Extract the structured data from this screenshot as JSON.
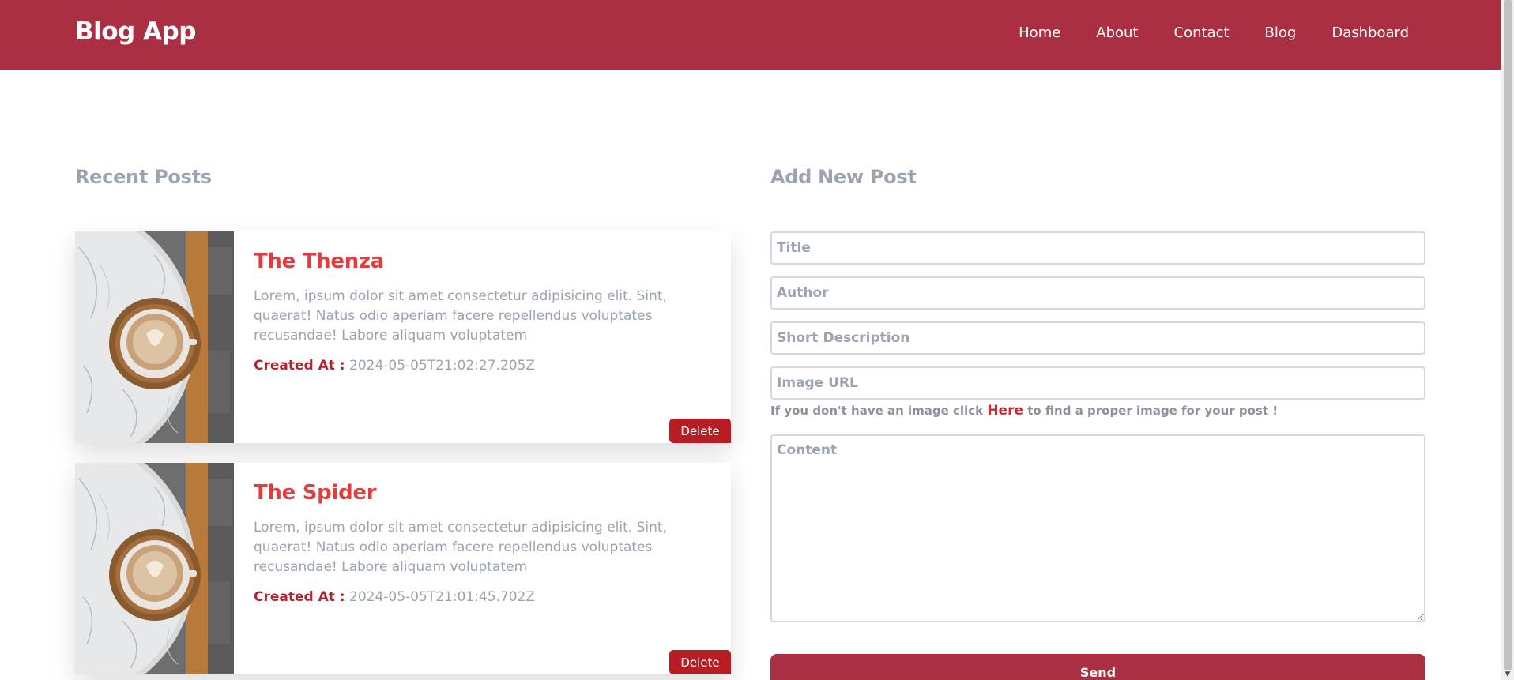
{
  "navbar": {
    "brand": "Blog App",
    "links": [
      "Home",
      "About",
      "Contact",
      "Blog",
      "Dashboard"
    ]
  },
  "recent_posts": {
    "heading": "Recent Posts",
    "created_label": "Created At :",
    "delete_label": "Delete",
    "posts": [
      {
        "title": "The Thenza",
        "description": "Lorem, ipsum dolor sit amet consectetur adipisicing elit. Sint, quaerat! Natus odio aperiam facere repellendus voluptates recusandae! Labore aliquam voluptatem",
        "created_at": "2024-05-05T21:02:27.205Z",
        "image": "coffee-on-marble-table"
      },
      {
        "title": "The Spider",
        "description": "Lorem, ipsum dolor sit amet consectetur adipisicing elit. Sint, quaerat! Natus odio aperiam facere repellendus voluptates recusandae! Labore aliquam voluptatem",
        "created_at": "2024-05-05T21:01:45.702Z",
        "image": "coffee-on-marble-table"
      }
    ]
  },
  "new_post": {
    "heading": "Add New Post",
    "title_placeholder": "Title",
    "author_placeholder": "Author",
    "short_description_placeholder": "Short Description",
    "image_url_placeholder": "Image URL",
    "hint_before": "If you don't have an image click",
    "hint_link": "Here",
    "hint_after": "to find a proper image for your post !",
    "content_placeholder": "Content",
    "send_label": "Send"
  },
  "colors": {
    "brand": "#ab2f43",
    "post_title": "#e03e3e",
    "delete_button": "#b71d22",
    "muted_text": "#9ba3b1"
  }
}
